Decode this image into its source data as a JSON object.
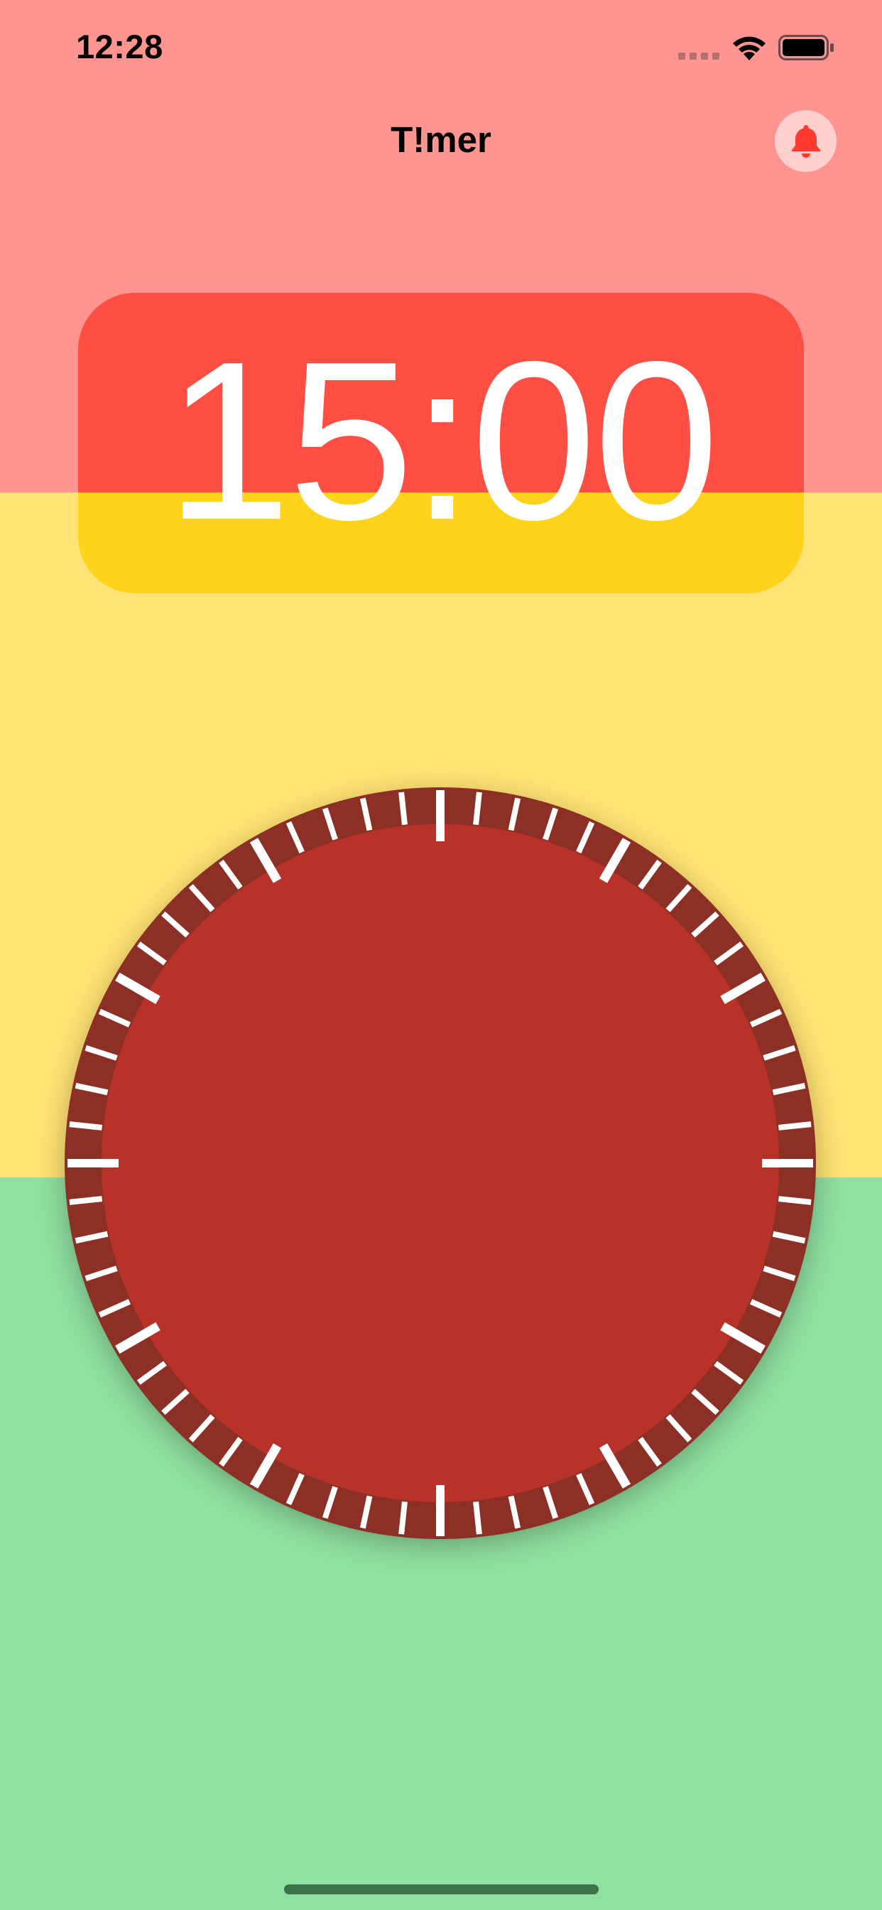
{
  "status_bar": {
    "time": "12:28",
    "signal_icon": "cellular-signal-icon",
    "wifi_icon": "wifi-icon",
    "battery_icon": "battery-full-icon"
  },
  "nav": {
    "title": "T!mer",
    "alarm_icon": "bell-icon"
  },
  "timer": {
    "display": "15:00",
    "dial_ticks": 60,
    "major_tick_every": 5
  },
  "colors": {
    "top_band": "#ff9490",
    "middle_band": "#ffe374",
    "bottom_band": "#90e0a2",
    "card_red": "#ff4e44",
    "card_yellow": "#ffd21c",
    "dial_face": "#b83229",
    "dial_rim": "#8c3026",
    "bell": "#ff3b30"
  }
}
